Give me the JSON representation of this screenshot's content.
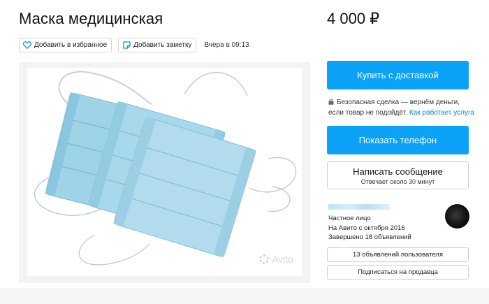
{
  "listing": {
    "title": "Маска медицинская",
    "price": "4 000 ₽",
    "date": "Вчера в 09:13"
  },
  "actions": {
    "favorite_label": "Добавить в избранное",
    "note_label": "Добавить заметку"
  },
  "gallery": {
    "watermark": "Avito"
  },
  "sidebar": {
    "buy_label": "Купить с доставкой",
    "safe_text": "Безопасная сделка — вернём деньги, если товар не подойдёт.",
    "safe_link": "Как работает услуга",
    "phone_label": "Показать телефон",
    "message_label": "Написать сообщение",
    "message_sub": "Отвечает около 30 минут"
  },
  "seller": {
    "type": "Частное лицо",
    "since": "На Авито с октября 2016",
    "completed": "Завершено 18 объявлений",
    "ads_button": "13 объявлений пользователя",
    "subscribe_button": "Подписаться на продавца"
  },
  "colors": {
    "accent": "#0ba2f7",
    "link": "#0a7ee0",
    "mask": "#a9d9ec"
  },
  "icons": {
    "favorite": "heart-icon",
    "note": "note-icon",
    "lock": "lock-icon"
  }
}
